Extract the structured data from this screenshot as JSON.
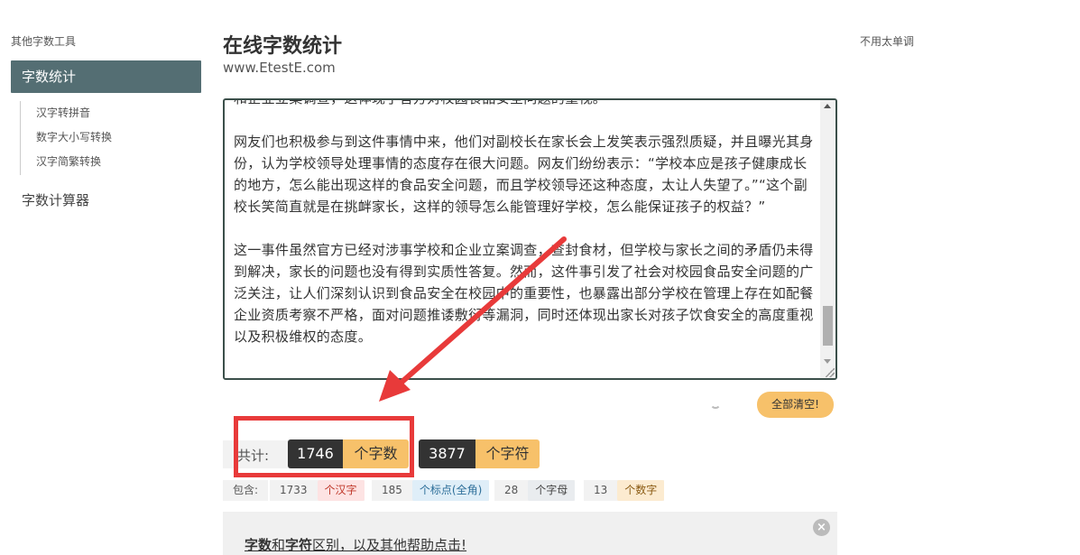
{
  "sidebar": {
    "title": "其他字数工具",
    "active": "字数统计",
    "sub_items": [
      "汉字转拼音",
      "数字大小写转换",
      "汉字简繁转换"
    ],
    "item2": "字数计算器"
  },
  "header": {
    "title": "在线字数统计",
    "subtitle": "www.EtestE.com",
    "right_link": "不用太单调"
  },
  "textarea": {
    "paragraphs": [
      "和企业立案调查，这体现了官方对校园食品安全问题的重视。",
      "网友们也积极参与到这件事情中来，他们对副校长在家长会上发笑表示强烈质疑，并且曝光其身份，认为学校领导处理事情的态度存在很大问题。网友们纷纷表示：“学校本应是孩子健康成长的地方，怎么能出现这样的食品安全问题，而且学校领导还这种态度，太让人失望了。”“这个副校长笑简直就是在挑衅家长，这样的领导怎么能管理好学校，怎么能保证孩子的权益？”",
      "这一事件虽然官方已经对涉事学校和企业立案调查，查封食材，但学校与家长之间的矛盾仍未得到解决，家长的问题也没有得到实质性答复。然而，这件事引发了社会对校园食品安全问题的广泛关注，让人们深刻认识到食品安全在校园中的重要性，也暴露出部分学校在管理上存在如配餐企业资质考察不严格，面对问题推诿敷衍等漏洞，同时还体现出家长对孩子饮食安全的高度重视以及积极维权的态度。"
    ]
  },
  "clear_button": "全部清空!",
  "stats": {
    "label": "共计:",
    "word_count": "1746",
    "word_unit": "个字数",
    "char_count": "3877",
    "char_unit": "个字符"
  },
  "sub_stats": {
    "label": "包含:",
    "hanzi": "1733",
    "hanzi_unit": "个汉字",
    "punct": "185",
    "punct_unit": "个标点(全角)",
    "letters": "28",
    "letters_unit": "个字母",
    "digits": "13",
    "digits_unit": "个数字"
  },
  "help": {
    "text_bold1": "字数",
    "text_mid1": "和",
    "text_bold2": "字符",
    "text_rest": "区别，以及其他帮助点击!",
    "close": "×"
  },
  "colors": {
    "sidebar_active_bg": "#546e73",
    "accent_yellow": "#f7c16a",
    "dark": "#333333",
    "annotation_red": "#e83a3a"
  }
}
